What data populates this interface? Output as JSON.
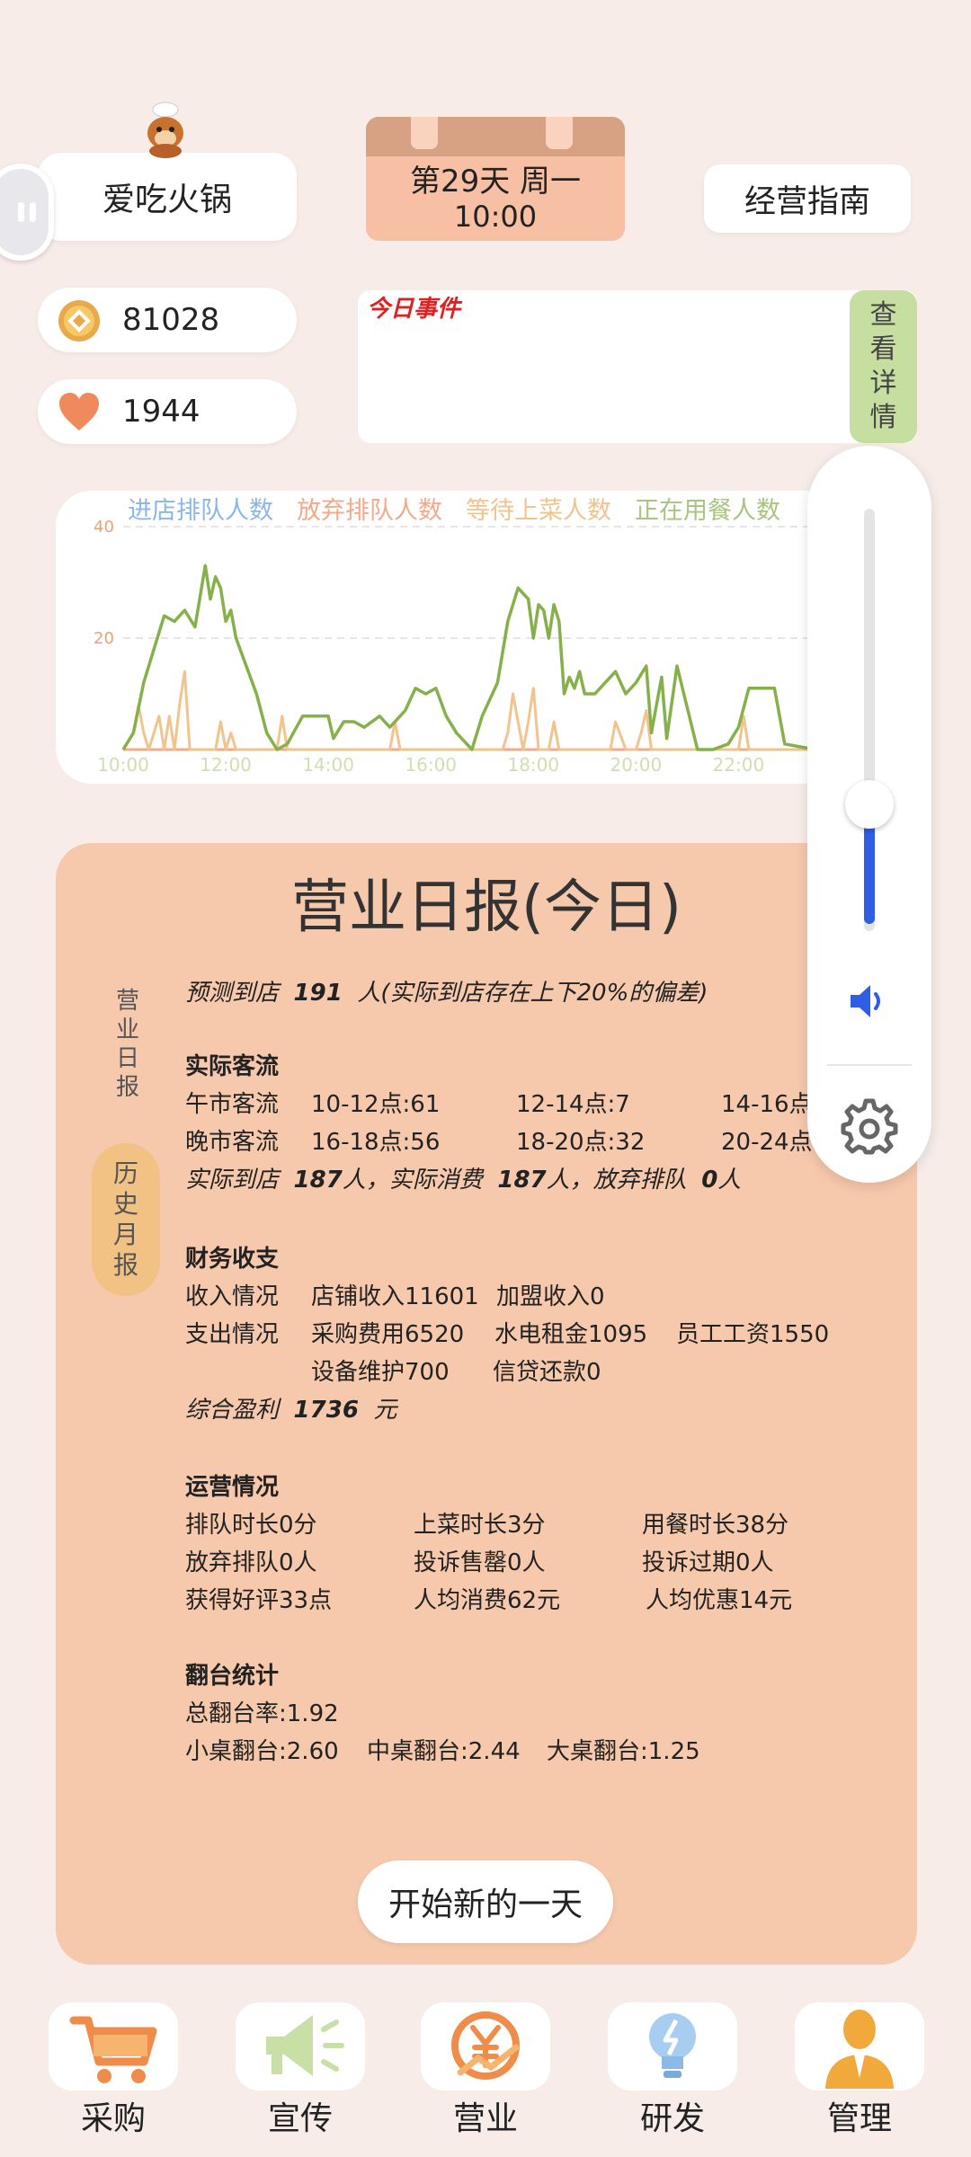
{
  "header": {
    "shop_name": "爱吃火锅",
    "day": "第29天 周一",
    "time": "10:00",
    "guide": "经营指南"
  },
  "stats": {
    "coins": "81028",
    "hearts": "1944"
  },
  "events": {
    "title": "今日事件",
    "detail_button": [
      "查",
      "看",
      "详",
      "情"
    ]
  },
  "chart_data": {
    "type": "line",
    "legend": [
      "进店排队人数",
      "放弃排队人数",
      "等待上菜人数",
      "正在用餐人数"
    ],
    "x_ticks": [
      "10:00",
      "12:00",
      "14:00",
      "16:00",
      "18:00",
      "20:00",
      "22:00"
    ],
    "y_ticks": [
      "40",
      "20"
    ],
    "ylim": [
      0,
      40
    ],
    "xlim": [
      10,
      23.5
    ],
    "colors": [
      "#8ab8e6",
      "#f4a98a",
      "#f0c48c",
      "#86b04a"
    ],
    "series": [
      {
        "name": "进店排队人数",
        "x": [
          10,
          23.5
        ],
        "y": [
          0,
          0
        ]
      },
      {
        "name": "放弃排队人数",
        "x": [
          10,
          23.5
        ],
        "y": [
          0,
          0
        ]
      },
      {
        "name": "等待上菜人数",
        "x": [
          10.0,
          10.2,
          10.3,
          10.4,
          10.5,
          10.6,
          10.7,
          10.8,
          10.9,
          11.0,
          11.1,
          11.2,
          11.3,
          11.8,
          11.9,
          12.0,
          12.1,
          12.2,
          13.0,
          13.1,
          13.2,
          13.3,
          15.2,
          15.3,
          15.4,
          17.4,
          17.5,
          17.6,
          17.8,
          17.9,
          18.0,
          18.1,
          18.3,
          18.4,
          18.5,
          18.6,
          19.5,
          19.6,
          19.8,
          20.0,
          20.1,
          20.2,
          20.3,
          20.4,
          22.0,
          22.1,
          22.2,
          22.3,
          23.5
        ],
        "y": [
          0,
          3,
          8,
          3,
          0,
          3,
          6,
          0,
          6,
          0,
          8,
          14,
          0,
          0,
          5,
          0,
          3,
          0,
          0,
          6,
          0,
          0,
          0,
          5,
          0,
          0,
          3,
          10,
          0,
          5,
          11,
          0,
          0,
          5,
          0,
          0,
          0,
          5,
          0,
          0,
          3,
          7,
          0,
          0,
          0,
          6,
          0,
          0,
          0
        ]
      },
      {
        "name": "正在用餐人数",
        "x": [
          10.0,
          10.2,
          10.4,
          10.6,
          10.8,
          11.0,
          11.2,
          11.4,
          11.6,
          11.7,
          11.8,
          11.9,
          12.0,
          12.1,
          12.2,
          12.4,
          12.6,
          12.8,
          13.0,
          13.2,
          13.5,
          13.6,
          14.0,
          14.1,
          14.3,
          14.5,
          14.7,
          15.0,
          15.2,
          15.5,
          15.7,
          15.9,
          16.1,
          16.3,
          16.5,
          16.8,
          17.0,
          17.3,
          17.5,
          17.7,
          17.9,
          18.0,
          18.1,
          18.2,
          18.3,
          18.4,
          18.5,
          18.6,
          18.7,
          18.8,
          18.9,
          19.0,
          19.2,
          19.4,
          19.6,
          19.8,
          20.0,
          20.2,
          20.3,
          20.5,
          20.6,
          20.8,
          21.2,
          21.5,
          21.8,
          22.0,
          22.2,
          22.3,
          22.7,
          22.9,
          23.5
        ],
        "y": [
          0,
          3,
          12,
          18,
          24,
          23,
          25,
          22,
          33,
          27,
          31,
          29,
          23,
          25,
          20,
          15,
          10,
          3,
          0,
          1,
          6,
          6,
          6,
          2,
          5,
          5,
          4,
          6,
          4,
          7,
          11,
          10,
          11,
          6,
          3,
          0,
          6,
          12,
          23,
          29,
          27,
          20,
          26,
          25,
          20,
          26,
          23,
          10,
          13,
          11,
          14,
          10,
          10,
          12,
          14,
          10,
          12,
          15,
          3,
          13,
          2,
          15,
          0,
          0,
          1,
          4,
          11,
          11,
          11,
          1,
          0
        ]
      }
    ]
  },
  "report": {
    "title": "营业日报(今日)",
    "tab_daily": [
      "营",
      "业",
      "日",
      "报"
    ],
    "tab_monthly": [
      "历",
      "史",
      "月",
      "报"
    ],
    "forecast_prefix": "预测到店",
    "forecast_value": "191",
    "forecast_suffix": "人(实际到店存在上下20%的偏差)",
    "actual_flow_heading": "实际客流",
    "lunch_label": "午市客流",
    "lunch_1": "10-12点:61",
    "lunch_2": "12-14点:7",
    "lunch_3": "14-16点:",
    "dinner_label": "晚市客流",
    "dinner_1": "16-18点:56",
    "dinner_2": "18-20点:32",
    "dinner_3": "20-24点",
    "arrival_prefix": "实际到店",
    "arrival_value": "187",
    "arrival_mid": "人，实际消费",
    "consume_value": "187",
    "abandon_mid": "人，放弃排队",
    "abandon_value": "0",
    "abandon_suffix": "人",
    "finance_heading": "财务收支",
    "income_label": "收入情况",
    "income_1": "店铺收入11601",
    "income_2": "加盟收入0",
    "expense_label": "支出情况",
    "expense_1": "采购费用6520",
    "expense_2": "水电租金1095",
    "expense_3": "员工工资1550",
    "expense_4": "设备维护700",
    "expense_5": "信贷还款0",
    "profit_prefix": "综合盈利",
    "profit_value": "1736",
    "profit_suffix": "元",
    "ops_heading": "运营情况",
    "ops": [
      "排队时长0分",
      "上菜时长3分",
      "用餐时长38分",
      "放弃排队0人",
      "投诉售罄0人",
      "投诉过期0人",
      "获得好评33点",
      "人均消费62元",
      "人均优惠14元"
    ],
    "turnover_heading": "翻台统计",
    "turnover_total": "总翻台率:1.92",
    "turnover_small": "小桌翻台:2.60",
    "turnover_mid": "中桌翻台:2.44",
    "turnover_large": "大桌翻台:1.25",
    "start_button": "开始新的一天"
  },
  "volume": {
    "level": 0.27,
    "icons": [
      "speaker-icon",
      "gear-icon"
    ],
    "accent": "#2f5de4"
  },
  "nav": [
    {
      "label": "采购",
      "icon": "cart-icon"
    },
    {
      "label": "宣传",
      "icon": "megaphone-icon"
    },
    {
      "label": "营业",
      "icon": "yen-growth-icon"
    },
    {
      "label": "研发",
      "icon": "lightbulb-icon"
    },
    {
      "label": "管理",
      "icon": "manager-icon"
    }
  ]
}
